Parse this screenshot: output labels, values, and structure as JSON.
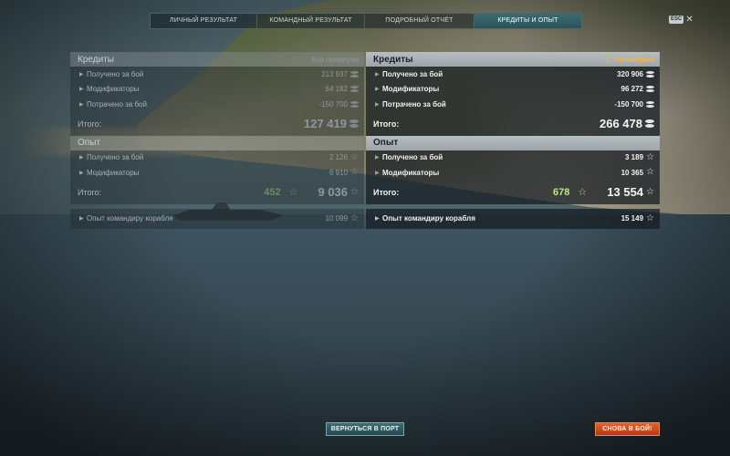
{
  "tabs": [
    {
      "label": "ЛИЧНЫЙ РЕЗУЛЬТАТ",
      "active": false
    },
    {
      "label": "КОМАНДНЫЙ РЕЗУЛЬТАТ",
      "active": false
    },
    {
      "label": "ПОДРОБНЫЙ ОТЧЁТ",
      "active": false
    },
    {
      "label": "КРЕДИТЫ И ОПЫТ",
      "active": true
    }
  ],
  "esc": {
    "key": "ESC",
    "close": "✕"
  },
  "left": {
    "credits": {
      "title": "Кредиты",
      "tag": "Без премиума",
      "rows": [
        {
          "label": "Получено за бой",
          "value": "213 937"
        },
        {
          "label": "Модификаторы",
          "value": "64 182"
        },
        {
          "label": "Потрачено за бой",
          "value": "-150 700"
        }
      ],
      "total_label": "Итого:",
      "total_value": "127 419"
    },
    "xp": {
      "title": "Опыт",
      "rows": [
        {
          "label": "Получено за бой",
          "value": "2 126"
        },
        {
          "label": "Модификаторы",
          "value": "6 910"
        }
      ],
      "total_label": "Итого:",
      "total_base": "452",
      "total_value": "9 036"
    },
    "commander": {
      "label": "Опыт командиру корабля",
      "value": "10 099"
    }
  },
  "right": {
    "credits": {
      "title": "Кредиты",
      "tag": "С премиумом",
      "rows": [
        {
          "label": "Получено за бой",
          "value": "320 906"
        },
        {
          "label": "Модификаторы",
          "value": "96 272"
        },
        {
          "label": "Потрачено за бой",
          "value": "-150 700"
        }
      ],
      "total_label": "Итого:",
      "total_value": "266 478"
    },
    "xp": {
      "title": "Опыт",
      "rows": [
        {
          "label": "Получено за бой",
          "value": "3 189"
        },
        {
          "label": "Модификаторы",
          "value": "10 365"
        }
      ],
      "total_label": "Итого:",
      "total_base": "678",
      "total_value": "13 554"
    },
    "commander": {
      "label": "Опыт командиру корабля",
      "value": "15 149"
    }
  },
  "buttons": {
    "port": "ВЕРНУТЬСЯ В ПОРТ",
    "battle": "СНОВА В БОЙ!"
  },
  "colors": {
    "premium_tag": "#f4b443",
    "battle_button": "#d24e1f",
    "port_button": "#35606a",
    "xp_base_premium": "#b8e878"
  }
}
